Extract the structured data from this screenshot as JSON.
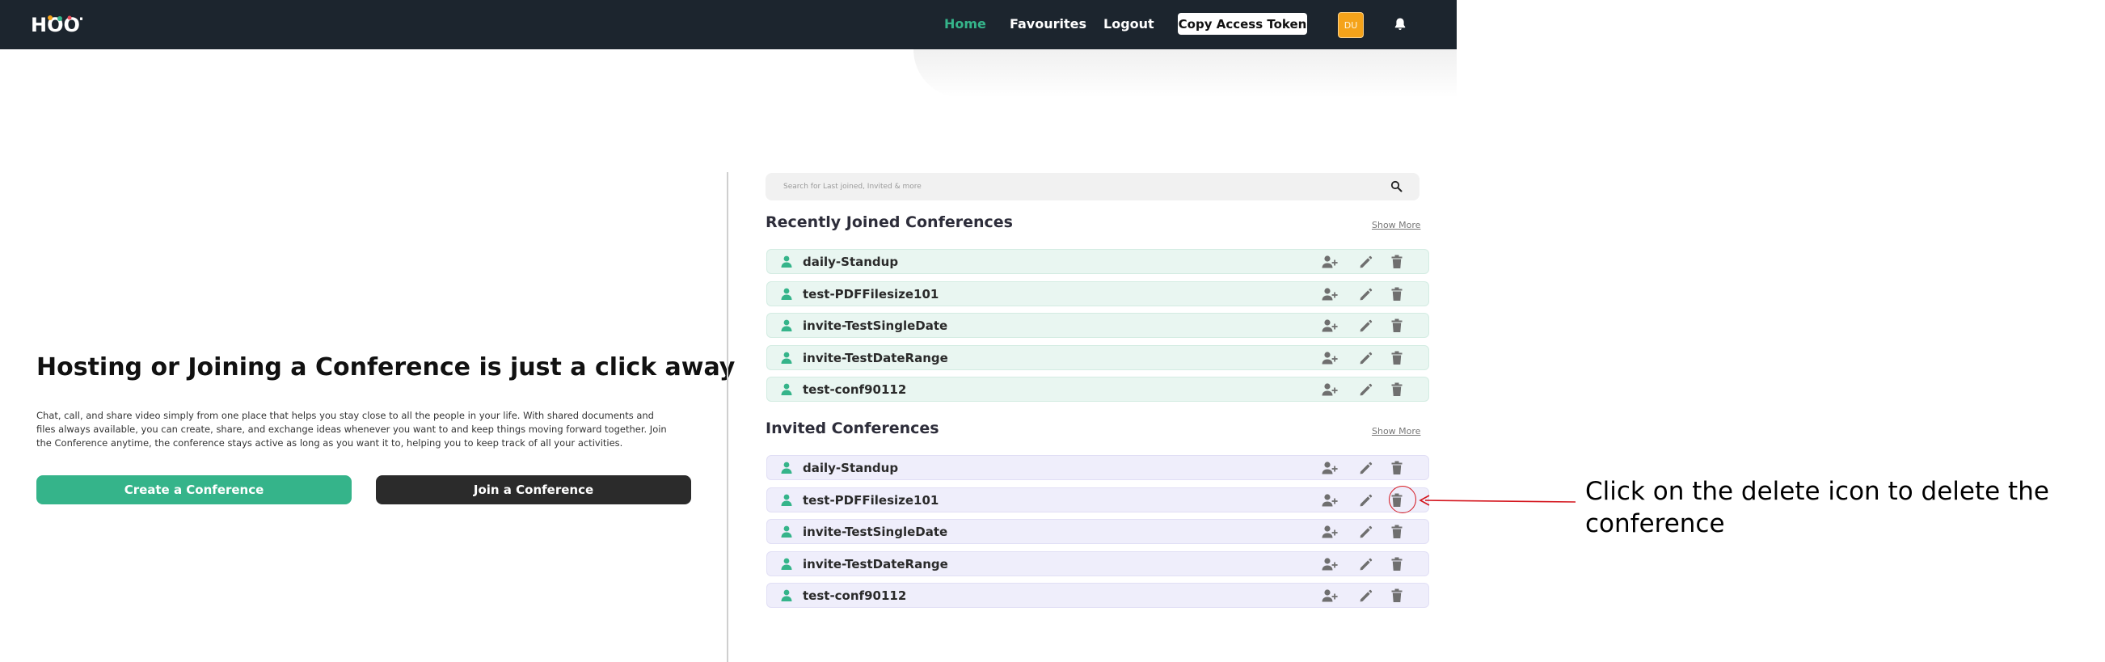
{
  "nav": {
    "logo_text": "HOOT",
    "home": "Home",
    "favourites": "Favourites",
    "logout": "Logout",
    "copy_token": "Copy Access Token",
    "avatar_initials": "DU"
  },
  "hero": {
    "title": "Hosting or Joining a Conference is just a click away",
    "description": "Chat, call, and share video simply from one place that helps you stay close to all the people in your life. With shared documents and files always available, you can create, share, and exchange ideas whenever you want to and keep things moving forward together. Join the Conference anytime, the conference stays active as long as you want it to, helping you to keep track of all your activities.",
    "create_button": "Create a Conference",
    "join_button": "Join a Conference"
  },
  "search": {
    "placeholder": "Search for Last joined, Invited & more"
  },
  "recent": {
    "title": "Recently Joined Conferences",
    "show_more": "Show More",
    "items": [
      {
        "name": "daily-Standup"
      },
      {
        "name": "test-PDFFilesize101"
      },
      {
        "name": "invite-TestSingleDate"
      },
      {
        "name": "invite-TestDateRange"
      },
      {
        "name": "test-conf90112"
      }
    ]
  },
  "invited": {
    "title": "Invited Conferences",
    "show_more": "Show More",
    "items": [
      {
        "name": "daily-Standup"
      },
      {
        "name": "test-PDFFilesize101"
      },
      {
        "name": "invite-TestSingleDate"
      },
      {
        "name": "invite-TestDateRange"
      },
      {
        "name": "test-conf90112"
      }
    ]
  },
  "annotation": {
    "text": "Click on the delete icon to delete the conference"
  },
  "colors": {
    "accent": "#35b48a",
    "topbar": "#1c252e",
    "annotation": "#d4151d"
  }
}
